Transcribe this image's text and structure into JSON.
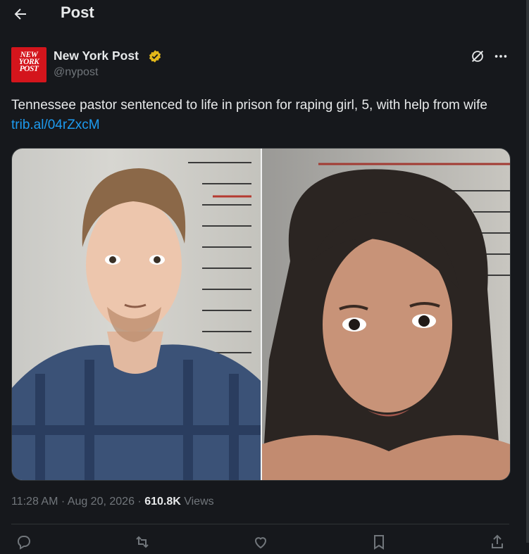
{
  "header": {
    "title": "Post"
  },
  "author": {
    "name": "New York Post",
    "handle": "@nypost",
    "logo_lines": [
      "NEW",
      "YORK",
      "POST"
    ]
  },
  "post": {
    "text": "Tennessee pastor sentenced to life in prison for raping girl, 5, with help from wife",
    "link": "trib.al/04rZxcM"
  },
  "meta": {
    "time": "11:28 AM",
    "sep1": " · ",
    "date": "Aug 20, 2026",
    "sep2": " · ",
    "views_count": "610.8K",
    "views_label": " Views"
  },
  "colors": {
    "background": "#16181c",
    "link": "#1d9bf0",
    "muted": "#71767b",
    "brand_red": "#d4151c",
    "verified_gold": "#e2b719"
  },
  "icons": [
    "back-arrow-icon",
    "verified-gold-badge-icon",
    "grok-icon",
    "more-icon",
    "reply-icon",
    "repost-icon",
    "like-icon",
    "bookmark-icon",
    "share-icon"
  ]
}
